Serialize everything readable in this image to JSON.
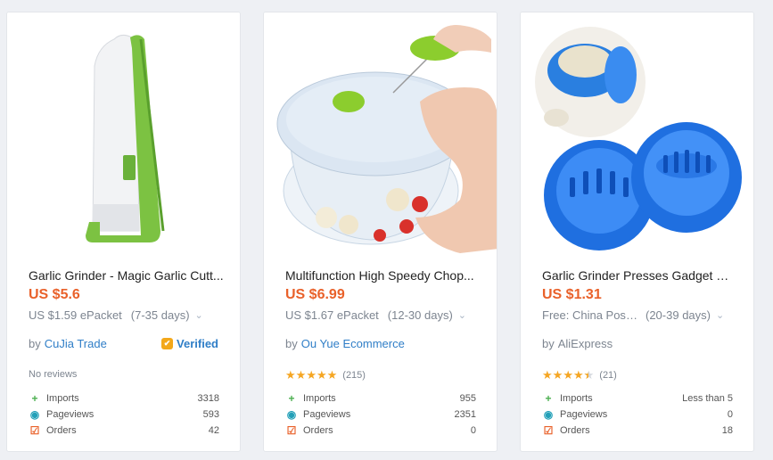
{
  "products": [
    {
      "title": "Garlic Grinder - Magic Garlic Cutt...",
      "price": "US $5.6",
      "shipping_method": "US $1.59 ePacket",
      "shipping_days": "(7-35 days)",
      "seller_prefix": "by",
      "seller_name": "CuJia Trade",
      "verified_label": "Verified",
      "reviews_text": "No reviews",
      "rating": 0,
      "stats": {
        "imports_label": "Imports",
        "imports": "3318",
        "pageviews_label": "Pageviews",
        "pageviews": "593",
        "orders_label": "Orders",
        "orders": "42"
      }
    },
    {
      "title": "Multifunction High Speedy Chop...",
      "price": "US $6.99",
      "shipping_method": "US $1.67 ePacket",
      "shipping_days": "(12-30 days)",
      "seller_prefix": "by",
      "seller_name": "Ou Yue Ecommerce",
      "reviews_text": "(215)",
      "rating": 5,
      "stats": {
        "imports_label": "Imports",
        "imports": "955",
        "pageviews_label": "Pageviews",
        "pageviews": "2351",
        "orders_label": "Orders",
        "orders": "0"
      }
    },
    {
      "title": "Garlic Grinder Presses Gadget Gi...",
      "price": "US $1.31",
      "shipping_method": "Free: China Post ...",
      "shipping_days": "(20-39 days)",
      "seller_prefix": "by",
      "seller_name": "AliExpress",
      "reviews_text": "(21)",
      "rating": 4.5,
      "stats": {
        "imports_label": "Imports",
        "imports": "Less than 5",
        "pageviews_label": "Pageviews",
        "pageviews": "0",
        "orders_label": "Orders",
        "orders": "18"
      }
    }
  ],
  "icons": {
    "imports": "plus-icon",
    "pageviews": "eye-icon",
    "orders": "cart-check-icon",
    "chevron": "chevron-down-icon",
    "verified": "verified-badge-icon"
  },
  "colors": {
    "price": "#e9612a",
    "link": "#2f7ec7",
    "star": "#f5a623"
  }
}
